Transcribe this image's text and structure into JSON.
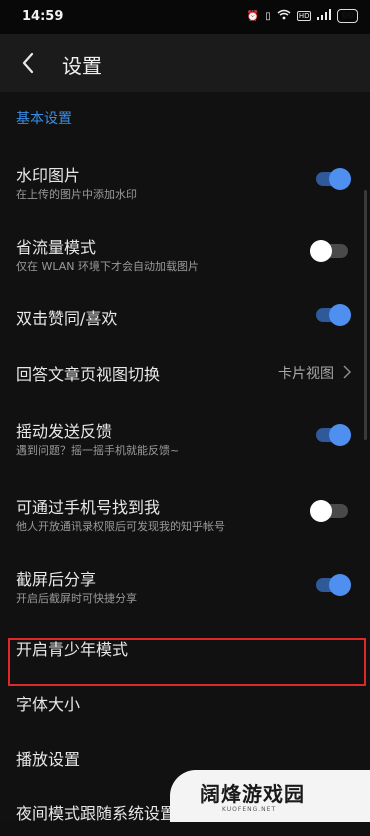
{
  "status": {
    "time": "14:59",
    "battery": "60",
    "network": "HD"
  },
  "nav": {
    "title": "设置"
  },
  "section": {
    "header": "基本设置"
  },
  "settings": [
    {
      "title": "水印图片",
      "subtitle": "在上传的图片中添加水印",
      "toggle": "on"
    },
    {
      "title": "省流量模式",
      "subtitle": "仅在 WLAN 环境下才会自动加载图片",
      "toggle": "off"
    },
    {
      "title": "双击赞同/喜欢",
      "toggle": "on"
    },
    {
      "title": "回答文章页视图切换",
      "value": "卡片视图"
    },
    {
      "title": "摇动发送反馈",
      "subtitle": "遇到问题？摇一摇手机就能反馈~",
      "toggle": "on"
    },
    {
      "title": "可通过手机号找到我",
      "subtitle": "他人开放通讯录权限后可发现我的知乎帐号",
      "toggle": "off"
    },
    {
      "title": "截屏后分享",
      "subtitle": "开启后截屏时可快捷分享",
      "toggle": "on"
    },
    {
      "title": "开启青少年模式"
    },
    {
      "title": "字体大小"
    },
    {
      "title": "播放设置"
    },
    {
      "title": "夜间模式跟随系统设置"
    }
  ],
  "watermark": {
    "text": "阔烽游戏园",
    "sub": "KUOFENG.NET"
  },
  "colors": {
    "accent": "#4f8ff0",
    "section": "#3a8ee6",
    "highlight": "#e02828"
  }
}
